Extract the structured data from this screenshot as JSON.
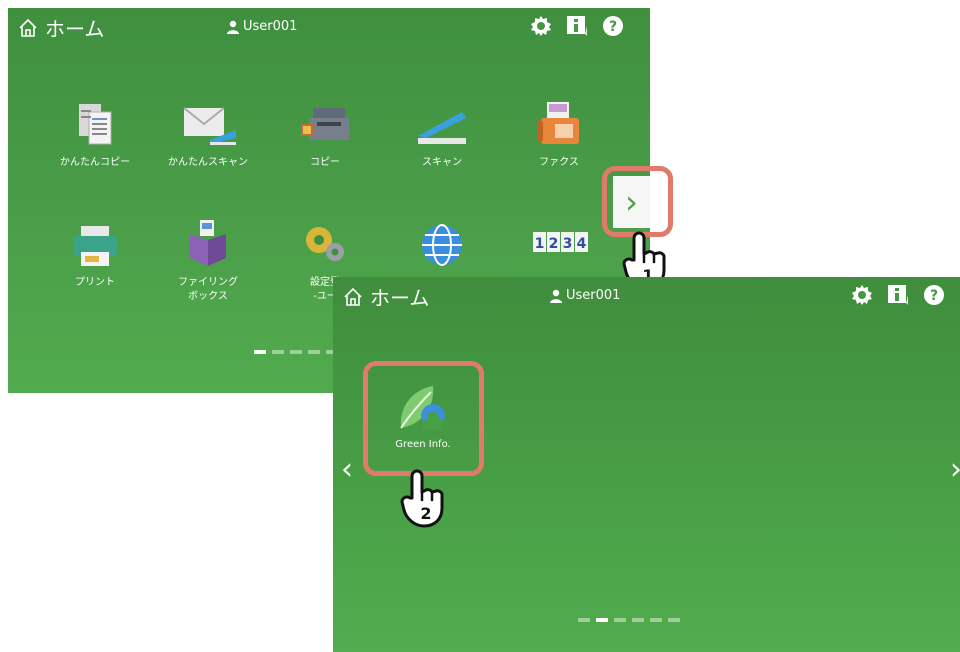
{
  "screen1": {
    "home_label": "ホーム",
    "user": "User001",
    "apps": [
      {
        "label": "かんたんコピー",
        "icon": "easy-copy-icon"
      },
      {
        "label": "かんたんスキャン",
        "icon": "easy-scan-icon"
      },
      {
        "label": "コピー",
        "icon": "copy-icon"
      },
      {
        "label": "スキャン",
        "icon": "scan-icon"
      },
      {
        "label": "ファクス",
        "icon": "fax-icon"
      },
      {
        "label": "プリント",
        "icon": "print-icon"
      },
      {
        "label": "ファイリング\nボックス",
        "icon": "filing-box-icon"
      },
      {
        "label": "設定登\n-ユー",
        "icon": "settings-gears-icon"
      },
      {
        "label": "",
        "icon": "globe-icon"
      },
      {
        "label": "",
        "icon": "counter-icon"
      }
    ],
    "next_arrow": "›",
    "page_count": 6,
    "active_page": 0
  },
  "screen2": {
    "home_label": "ホーム",
    "user": "User001",
    "app_label": "Green Info.",
    "prev_arrow": "‹",
    "next_arrow": "›",
    "page_count": 6,
    "active_page": 1
  },
  "steps": {
    "one": "1",
    "two": "2"
  },
  "colors": {
    "callout": "#e07a6a",
    "screen_green": "#4a9e48"
  }
}
